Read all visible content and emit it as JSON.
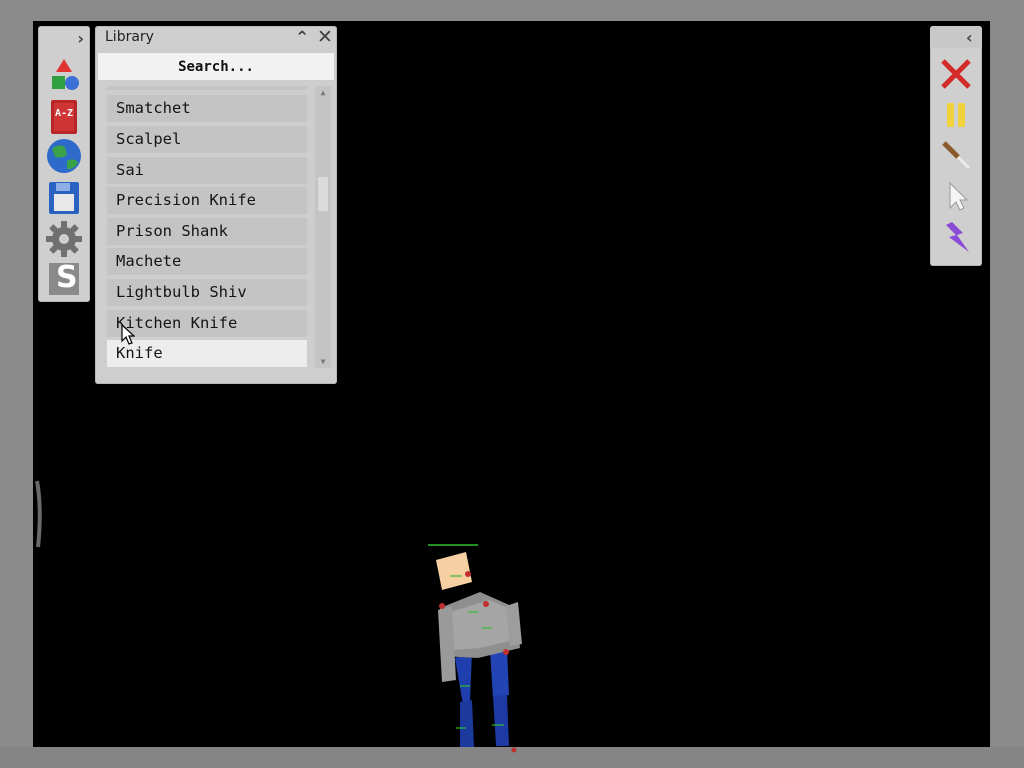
{
  "left_toolbar": {
    "expand_glyph": "›",
    "tools": [
      "shapes-icon",
      "catalog-book-icon",
      "globe-icon",
      "save-disk-icon",
      "settings-gear-icon",
      "logo-s-icon"
    ],
    "book_label": "A-Z",
    "logo_letter": "S"
  },
  "library": {
    "title": "Library",
    "collapse_glyph": "⌃",
    "close_glyph": "✕",
    "search_placeholder": "Search...",
    "items": [
      "Smatchet",
      "Scalpel",
      "Sai",
      "Precision Knife",
      "Prison Shank",
      "Machete",
      "Lightbulb Shiv",
      "Kitchen Knife",
      "Knife"
    ],
    "selected_item": "Knife",
    "scroll_position": 0.35
  },
  "right_toolbar": {
    "collapse_glyph": "‹",
    "tools": [
      "delete-x-icon",
      "pause-icon",
      "syringe-tool-icon",
      "pointer-cursor-icon",
      "lightning-power-icon"
    ]
  },
  "colors": {
    "stage": "#000000",
    "panel": "#cecece",
    "item": "#c4c4c4",
    "item_selected": "#ededed",
    "delete": "#d42a2a",
    "pause": "#f0d23c",
    "lightning": "#8a4cd6"
  }
}
